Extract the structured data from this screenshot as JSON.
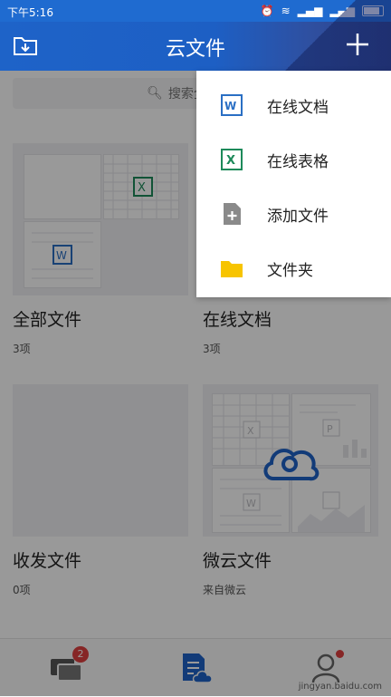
{
  "status_bar": {
    "time": "下午5:16"
  },
  "app_bar": {
    "title": "云文件"
  },
  "search": {
    "placeholder": "搜索全部文件"
  },
  "tiles": [
    {
      "title": "全部文件",
      "subtitle": "3项"
    },
    {
      "title": "在线文档",
      "subtitle": "3项"
    },
    {
      "title": "收发文件",
      "subtitle": "0项"
    },
    {
      "title": "微云文件",
      "subtitle": "来自微云"
    }
  ],
  "menu": {
    "items": [
      {
        "label": "在线文档",
        "icon": "word-doc-icon",
        "color": "#2a6fc4"
      },
      {
        "label": "在线表格",
        "icon": "excel-sheet-icon",
        "color": "#1d8a5a"
      },
      {
        "label": "添加文件",
        "icon": "add-file-icon",
        "color": "#8a8a8a"
      },
      {
        "label": "文件夹",
        "icon": "folder-icon",
        "color": "#f7c400"
      }
    ]
  },
  "bottom_nav": {
    "messages_badge": "2",
    "watermark": "jingyan.baidu.com"
  },
  "colors": {
    "accent": "#1e63c8",
    "badge": "#e04040"
  }
}
